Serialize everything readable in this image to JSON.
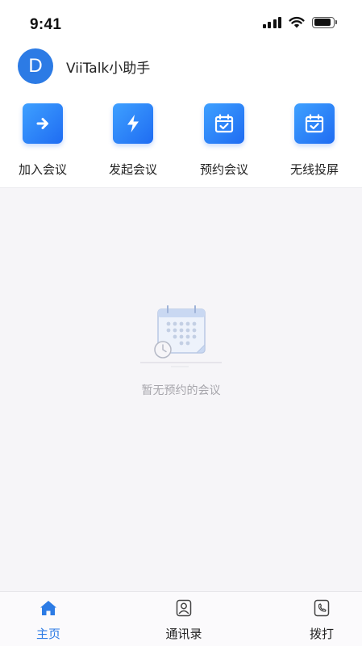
{
  "status_bar": {
    "time": "9:41",
    "battery_level": 0.9
  },
  "header": {
    "avatar_initial": "D",
    "title": "ViiTalk小助手"
  },
  "actions": [
    {
      "label": "加入会议",
      "icon": "arrow-right-icon"
    },
    {
      "label": "发起会议",
      "icon": "lightning-icon"
    },
    {
      "label": "预约会议",
      "icon": "calendar-check-icon"
    },
    {
      "label": "无线投屏",
      "icon": "calendar-check-icon"
    }
  ],
  "empty_state": {
    "icon": "calendar-clock-icon",
    "text": "暂无预约的会议"
  },
  "tabbar": {
    "active": "home",
    "tabs": [
      {
        "label": "主页",
        "icon": "home-icon"
      },
      {
        "label": "通讯录",
        "icon": "contacts-icon"
      },
      {
        "label": "拨打",
        "icon": "phone-icon"
      }
    ]
  },
  "colors": {
    "accent": "#2c7be5",
    "background": "#f6f5f8",
    "muted_text": "#a6a5ab"
  }
}
